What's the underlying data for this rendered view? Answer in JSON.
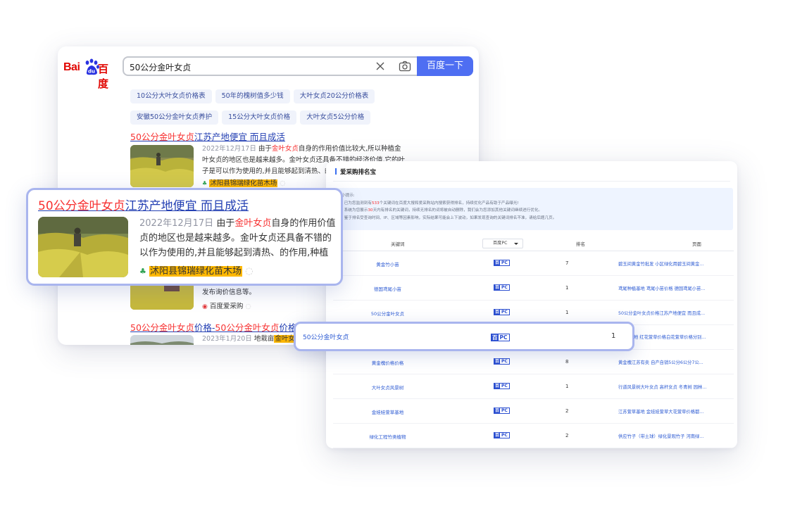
{
  "baidu": {
    "logo_bai": "Bai",
    "logo_du": "百度",
    "search_value": "50公分金叶女贞",
    "search_button": "百度一下",
    "icons": {
      "clear": "close-icon",
      "camera": "camera-icon"
    },
    "tags": [
      "10公分大叶女贞价格表",
      "50年的槐树值多少钱",
      "大叶女贞20公分价格表",
      "安徽50公分金叶女贞养护",
      "15公分大叶女贞价格",
      "大叶女贞5公分价格"
    ],
    "results": [
      {
        "title_hl": "50公分金叶女贞",
        "title_rest": "江苏产地便宜 而且成活",
        "date": "2022年12月17日",
        "text_a": "由于",
        "text_hl": "金叶女贞",
        "text_b": "自身的作用价值比较大,所以种植金叶女贞的地区也是越来越多。金叶女贞还具备不错的经济价值,它的叶子是可以作为使用的,并且能够起到清热、的作用,种植",
        "source": "沭阳县锦瑞绿化苗木场"
      },
      {
        "text_tail": "发布询价信息等。",
        "source": "百度爱采购"
      },
      {
        "title_hl1": "50公分金叶女贞",
        "title_mid": "价格-",
        "title_hl2": "50公分金叶女贞",
        "title_rest": "价格",
        "date": "2023年1月20日",
        "text_a": "地栽亩",
        "text_hl": "金叶女贞"
      }
    ]
  },
  "zoom": {
    "title_hl": "50公分金叶女贞",
    "title_rest": "江苏产地便宜 而且成活",
    "date": "2022年12月17日",
    "line1_a": "由于",
    "line1_hl": "金叶女贞",
    "line1_b": "自身的作用价值",
    "line2": "贞的地区也是越来越多。金叶女贞还具备不错的",
    "line3": "以作为使用的,并且能够起到清热、的作用,种植",
    "source": "沭阳县锦瑞绿化苗木场"
  },
  "rank": {
    "header": "爱采购排名宝",
    "tips_title": "小提示:",
    "tip1_a": "- 已为您监测到有",
    "tip1_n": "533",
    "tip1_b": "个关键词在百度大搜和爱采购站内搜索获得排名，持续优化产品有助于产品曝光!",
    "tip2_a": "- 系统为您展示",
    "tip2_n": "30",
    "tip2_b": "天内有排名的关键词，持续无排名的词将被自动删除，我们会为您添加其他关键词继续进行优化。",
    "tip3": "- 鉴于排名受查询时间、IP、区域等因素影响，实际结果可能会上下波动，如果发现查询的关键词排名不准，请给后题几页。",
    "col_keyword": "关键词",
    "col_platform": "百度PC",
    "col_rank": "排名",
    "col_page": "页面",
    "badge_a": "百",
    "badge_b": "PC",
    "rows": [
      {
        "keyword": "黄金竹小苗",
        "rank": "7",
        "page": "碧玉间黄金竹批发 小区绿化用碧玉间黄金..."
      },
      {
        "keyword": "德国鸢尾小苗",
        "rank": "1",
        "page": "鸢尾种植基地 鸢尾小苗价格 德国鸢尾小苗..."
      },
      {
        "keyword": "50公分金叶女贞",
        "rank": "1",
        "page": "50公分金叶女贞价格江苏产地便宜 而且成..."
      },
      {
        "keyword": "",
        "rank": "",
        "page": ""
      },
      {
        "keyword": "黄金槐价格价格",
        "rank": "8",
        "page": "黄金槐江苏有卖 自产自销5公分6公分7公..."
      },
      {
        "keyword": "大叶女贞风景树",
        "rank": "1",
        "page": "行道风景树大叶女贞 高杆女贞 冬青树 园林..."
      },
      {
        "keyword": "金娃娃萱草基地",
        "rank": "2",
        "page": "江苏萱草基地 金娃娃萱草大花萱草价格都..."
      },
      {
        "keyword": "绿化工程竹类植物",
        "rank": "2",
        "page": "供应竹子（带土球）绿化景观竹子 河南绿..."
      }
    ],
    "callout": {
      "keyword": "50公分金叶女贞",
      "rank": "1"
    },
    "callout_page_tail": "地 红花萱草价格白花萱草价格分别..."
  }
}
